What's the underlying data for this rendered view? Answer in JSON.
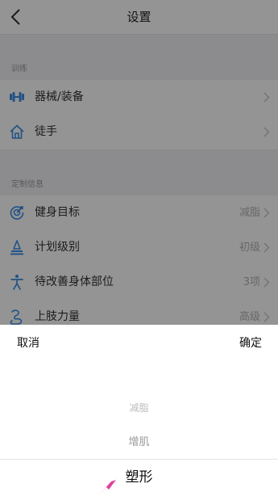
{
  "header": {
    "title": "设置",
    "back_icon": "chevron-left-icon"
  },
  "sections": {
    "training": {
      "title": "训练",
      "items": [
        {
          "label": "器械/装备",
          "value": "",
          "icon": "dumbbell-icon"
        },
        {
          "label": "徒手",
          "value": "",
          "icon": "home-icon"
        }
      ]
    },
    "custom": {
      "title": "定制信息",
      "items": [
        {
          "label": "健身目标",
          "value": "减脂",
          "icon": "target-icon"
        },
        {
          "label": "计划级别",
          "value": "初级",
          "icon": "level-icon"
        },
        {
          "label": "待改善身体部位",
          "value": "3项",
          "icon": "body-icon"
        },
        {
          "label": "上肢力量",
          "value": "高级",
          "icon": "arm-icon"
        }
      ]
    }
  },
  "picker": {
    "cancel_label": "取消",
    "confirm_label": "确定",
    "options": [
      "减脂",
      "增肌",
      "塑形"
    ],
    "selected": "塑形"
  },
  "colors": {
    "accent": "#3a8ee6",
    "overlay": "rgba(0,0,0,0.42)",
    "cursor": "#e0409a"
  }
}
